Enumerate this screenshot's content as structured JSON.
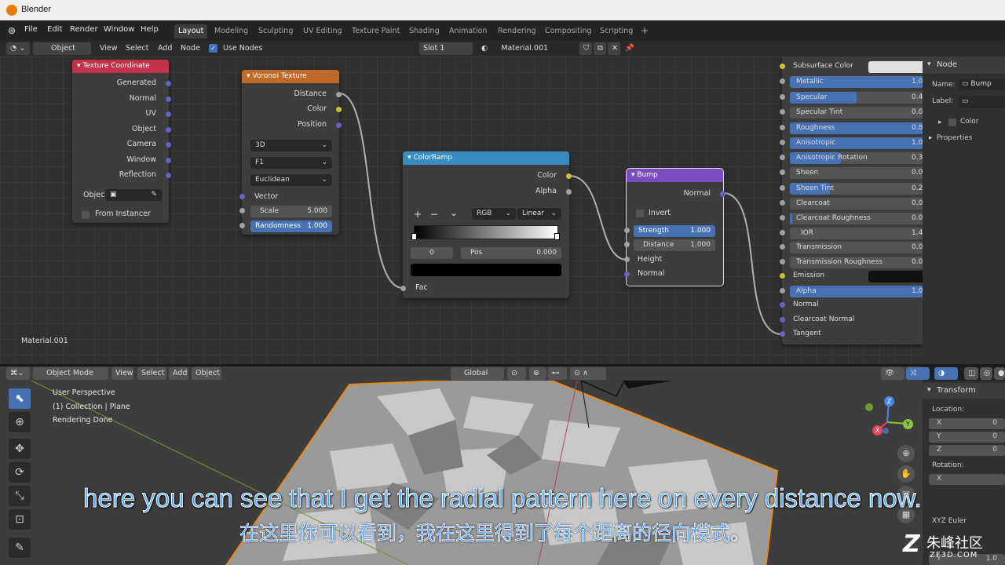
{
  "window": {
    "title": "Blender"
  },
  "menu": {
    "items": [
      "File",
      "Edit",
      "Render",
      "Window",
      "Help"
    ]
  },
  "workspaces": {
    "tabs": [
      "Layout",
      "Modeling",
      "Sculpting",
      "UV Editing",
      "Texture Paint",
      "Shading",
      "Animation",
      "Rendering",
      "Compositing",
      "Scripting"
    ],
    "add": "+"
  },
  "node_header": {
    "object": "Object",
    "view": "View",
    "select": "Select",
    "add": "Add",
    "node": "Node",
    "use_nodes": "Use Nodes",
    "slot": "Slot 1",
    "material": "Material.001"
  },
  "nodes": {
    "texcoord": {
      "title": "Texture Coordinate",
      "outputs": [
        "Generated",
        "Normal",
        "UV",
        "Object",
        "Camera",
        "Window",
        "Reflection"
      ],
      "object_label": "Objec",
      "from_instancer": "From Instancer"
    },
    "voronoi": {
      "title": "Voronoi Texture",
      "outputs": [
        "Distance",
        "Color",
        "Position"
      ],
      "dims": "3D",
      "feature": "F1",
      "metric": "Euclidean",
      "vector": "Vector",
      "scale_label": "Scale",
      "scale_value": "5.000",
      "rand_label": "Randomness",
      "rand_value": "1.000"
    },
    "colorramp": {
      "title": "ColorRamp",
      "outputs": [
        "Color",
        "Alpha"
      ],
      "plus": "+",
      "minus": "−",
      "chev": "⌄",
      "mode": "RGB",
      "interp": "Linear",
      "index": "0",
      "pos_label": "Pos",
      "pos_value": "0.000",
      "fac": "Fac"
    },
    "bump": {
      "title": "Bump",
      "output": "Normal",
      "invert": "Invert",
      "strength_label": "Strength",
      "strength_value": "1.000",
      "distance_label": "Distance",
      "distance_value": "1.000",
      "inputs": [
        "Height",
        "Normal"
      ]
    }
  },
  "principled": [
    {
      "label": "Subsurface Color",
      "value": "",
      "fill": 0,
      "socket": "y",
      "swatch": "#e0e0e0"
    },
    {
      "label": "Metallic",
      "value": "1.0",
      "fill": 1,
      "socket": "g"
    },
    {
      "label": "Specular",
      "value": "0.4",
      "fill": 0.5,
      "socket": "g"
    },
    {
      "label": "Specular Tint",
      "value": "0.0",
      "fill": 0,
      "socket": "g"
    },
    {
      "label": "Roughness",
      "value": "0.8",
      "fill": 1,
      "socket": "g"
    },
    {
      "label": "Anisotropic",
      "value": "1.0",
      "fill": 1,
      "socket": "g"
    },
    {
      "label": "Anisotropic Rotation",
      "value": "0.3",
      "fill": 0.38,
      "socket": "g"
    },
    {
      "label": "Sheen",
      "value": "0.0",
      "fill": 0,
      "socket": "g"
    },
    {
      "label": "Sheen Tint",
      "value": "0.2",
      "fill": 0.3,
      "socket": "g"
    },
    {
      "label": "Clearcoat",
      "value": "0.0",
      "fill": 0,
      "socket": "g"
    },
    {
      "label": "Clearcoat Roughness",
      "value": "0.0",
      "fill": 0.02,
      "socket": "g"
    },
    {
      "label": "IOR",
      "value": "1.45",
      "fill": 0,
      "socket": "g"
    },
    {
      "label": "Transmission",
      "value": "0.0",
      "fill": 0,
      "socket": "g"
    },
    {
      "label": "Transmission Roughness",
      "value": "0.0",
      "fill": 0,
      "socket": "g"
    },
    {
      "label": "Emission",
      "value": "",
      "fill": 0,
      "socket": "y",
      "swatch": "#111111"
    },
    {
      "label": "Alpha",
      "value": "1.0",
      "fill": 1,
      "socket": "g"
    },
    {
      "label": "Normal",
      "value": "",
      "fill": -1,
      "socket": "v"
    },
    {
      "label": "Clearcoat Normal",
      "value": "",
      "fill": -1,
      "socket": "v"
    },
    {
      "label": "Tangent",
      "value": "",
      "fill": -1,
      "socket": "v"
    }
  ],
  "node_editor_label": "Material.001",
  "npanel": {
    "tab": "Node",
    "name_label": "Name:",
    "name_value": "Bump",
    "label_label": "Label:",
    "color": "Color",
    "properties": "Properties"
  },
  "viewport_header": {
    "mode": "Object Mode",
    "view": "View",
    "select": "Select",
    "add": "Add",
    "object": "Object",
    "orientation": "Global"
  },
  "viewport_info": {
    "line1": "User Perspective",
    "line2": "(1) Collection | Plane",
    "line3": "Rendering Done"
  },
  "transform": {
    "title": "Transform",
    "location": "Location:",
    "rotation": "Rotation:",
    "axes": [
      "X",
      "Y",
      "Z"
    ],
    "loc_values": [
      "0",
      "0",
      "0"
    ],
    "rot_axes": [
      "X"
    ],
    "euler": "XYZ Euler",
    "scale_axis": "Y",
    "scale_value": "1.0"
  },
  "gizmo": {
    "x": "X",
    "y": "Y",
    "z": "Z"
  },
  "subtitles": {
    "en": "here you can see that I get the radial pattern here on every distance now.",
    "zh": "在这里你可以看到，我在这里得到了每个距离的径向模式。"
  },
  "watermark": {
    "cn": "朱峰社区",
    "en": "ZF3D.COM"
  },
  "colors": {
    "accent": "#4772b3",
    "texcoord_header": "#c2324a",
    "voronoi_header": "#c06a2a",
    "colorramp_header": "#3a8bbf",
    "bump_header": "#7a4dc0"
  }
}
